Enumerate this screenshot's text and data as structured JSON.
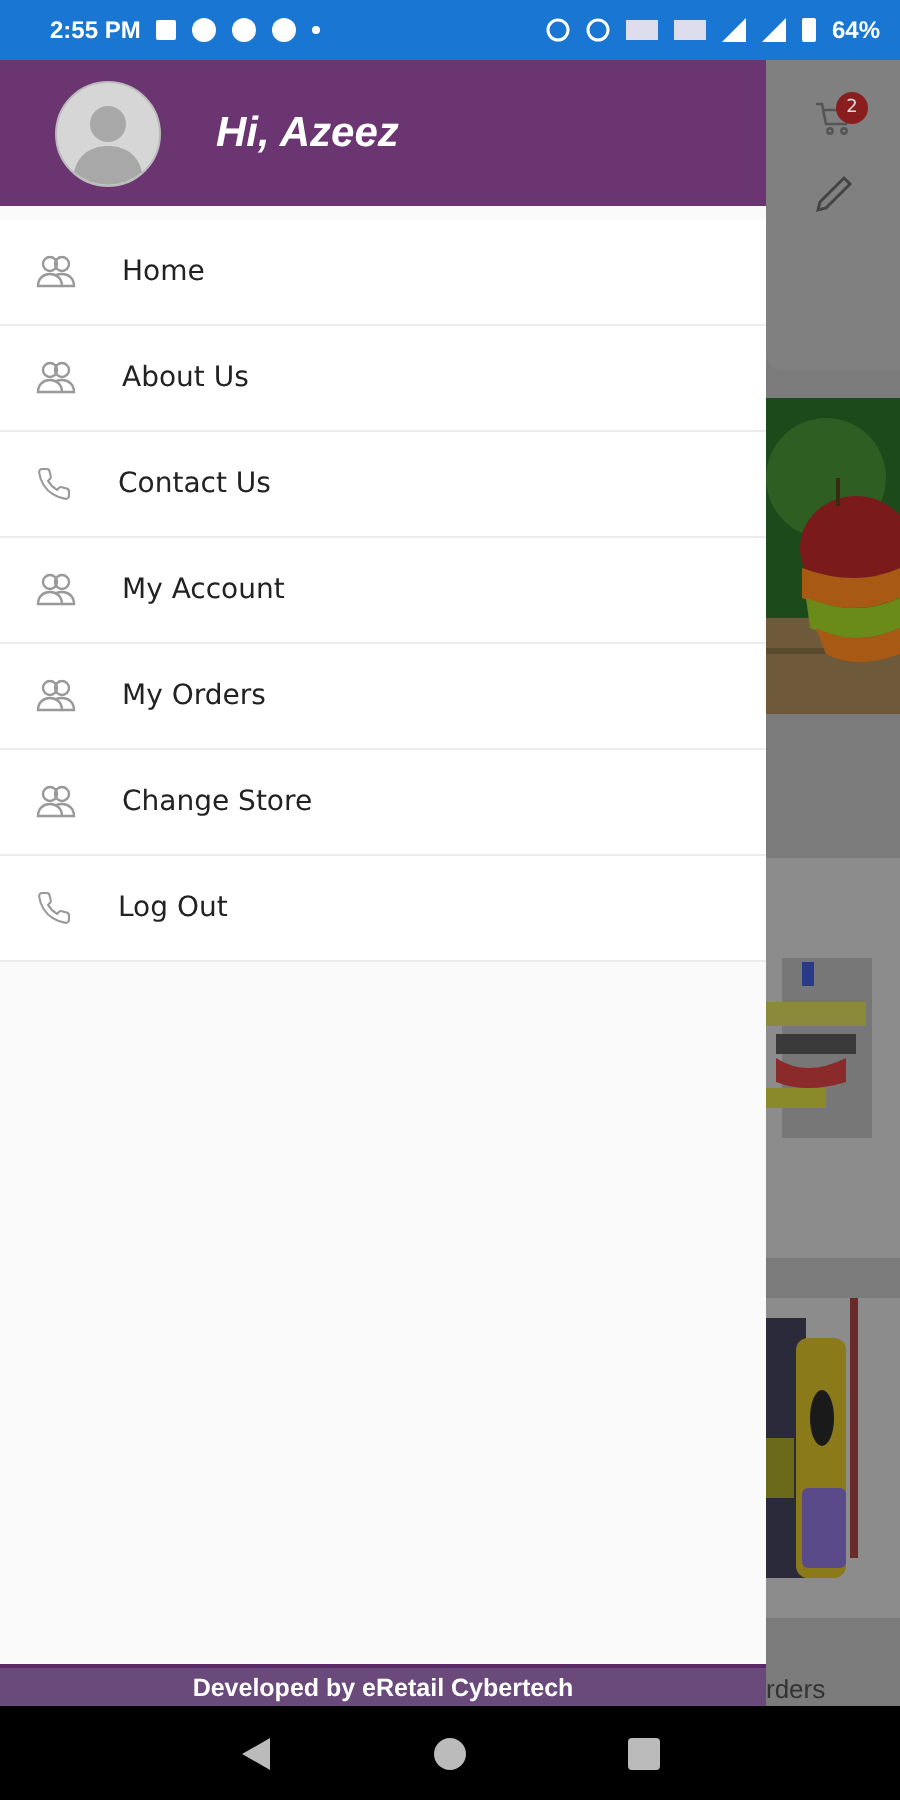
{
  "status_bar": {
    "time": "2:55 PM",
    "battery": "64%"
  },
  "drawer": {
    "greeting": "Hi, Azeez",
    "items": [
      {
        "label": "Home",
        "kind": "people"
      },
      {
        "label": "About Us",
        "kind": "people"
      },
      {
        "label": "Contact Us",
        "kind": "phone"
      },
      {
        "label": "My Account",
        "kind": "people"
      },
      {
        "label": "My Orders",
        "kind": "people"
      },
      {
        "label": "Change Store",
        "kind": "people"
      },
      {
        "label": "Log Out",
        "kind": "phone"
      }
    ],
    "footer": "Developed by eRetail Cybertech"
  },
  "background_page": {
    "cart_badge": "2",
    "bottom_tab": "rders"
  }
}
